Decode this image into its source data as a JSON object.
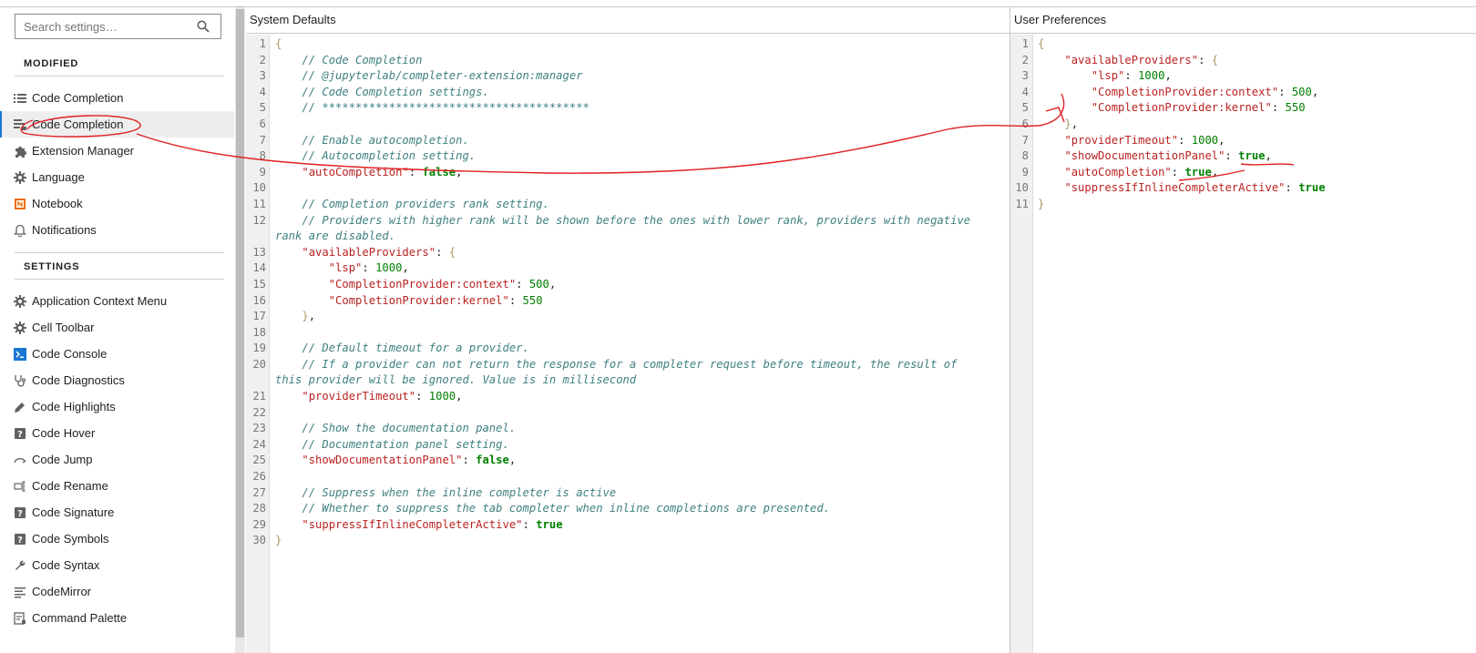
{
  "search": {
    "placeholder": "Search settings…"
  },
  "sidebar": {
    "modified_header": "MODIFIED",
    "settings_header": "SETTINGS",
    "modified_items": [
      {
        "label": "Code Completion",
        "icon": "list-icon"
      },
      {
        "label": "Code Completion",
        "icon": "completion-icon"
      },
      {
        "label": "Extension Manager",
        "icon": "puzzle-icon"
      },
      {
        "label": "Language",
        "icon": "gear-icon"
      },
      {
        "label": "Notebook",
        "icon": "notebook-icon"
      },
      {
        "label": "Notifications",
        "icon": "bell-icon"
      }
    ],
    "settings_items": [
      {
        "label": "Application Context Menu",
        "icon": "gear-icon"
      },
      {
        "label": "Cell Toolbar",
        "icon": "gear-icon"
      },
      {
        "label": "Code Console",
        "icon": "console-icon"
      },
      {
        "label": "Code Diagnostics",
        "icon": "stethoscope-icon"
      },
      {
        "label": "Code Highlights",
        "icon": "pen-icon"
      },
      {
        "label": "Code Hover",
        "icon": "help-icon"
      },
      {
        "label": "Code Jump",
        "icon": "jump-icon"
      },
      {
        "label": "Code Rename",
        "icon": "rename-icon"
      },
      {
        "label": "Code Signature",
        "icon": "help-icon"
      },
      {
        "label": "Code Symbols",
        "icon": "help-icon"
      },
      {
        "label": "Code Syntax",
        "icon": "wrench-icon"
      },
      {
        "label": "CodeMirror",
        "icon": "text-lines-icon"
      },
      {
        "label": "Command Palette",
        "icon": "palette-icon"
      }
    ]
  },
  "system_defaults": {
    "title": "System Defaults",
    "lines": [
      [
        [
          "p",
          "{"
        ]
      ],
      [
        [
          "t",
          "    "
        ],
        [
          "c",
          "// Code Completion"
        ]
      ],
      [
        [
          "t",
          "    "
        ],
        [
          "c",
          "// @jupyterlab/completer-extension:manager"
        ]
      ],
      [
        [
          "t",
          "    "
        ],
        [
          "c",
          "// Code Completion settings."
        ]
      ],
      [
        [
          "t",
          "    "
        ],
        [
          "c",
          "// ****************************************"
        ]
      ],
      [],
      [
        [
          "t",
          "    "
        ],
        [
          "c",
          "// Enable autocompletion."
        ]
      ],
      [
        [
          "t",
          "    "
        ],
        [
          "c",
          "// Autocompletion setting."
        ]
      ],
      [
        [
          "t",
          "    "
        ],
        [
          "k",
          "\"autoCompletion\""
        ],
        [
          "t",
          ": "
        ],
        [
          "b",
          "false"
        ],
        [
          "t",
          ","
        ]
      ],
      [],
      [
        [
          "t",
          "    "
        ],
        [
          "c",
          "// Completion providers rank setting."
        ]
      ],
      [
        [
          "t",
          "    "
        ],
        [
          "c",
          "// Providers with higher rank will be shown before the ones with lower rank, providers with negative"
        ]
      ],
      [
        [
          "c",
          "rank are disabled."
        ]
      ],
      [
        [
          "t",
          "    "
        ],
        [
          "k",
          "\"availableProviders\""
        ],
        [
          "t",
          ": "
        ],
        [
          "p",
          "{"
        ]
      ],
      [
        [
          "t",
          "        "
        ],
        [
          "k",
          "\"lsp\""
        ],
        [
          "t",
          ": "
        ],
        [
          "n",
          "1000"
        ],
        [
          "t",
          ","
        ]
      ],
      [
        [
          "t",
          "        "
        ],
        [
          "k",
          "\"CompletionProvider:context\""
        ],
        [
          "t",
          ": "
        ],
        [
          "n",
          "500"
        ],
        [
          "t",
          ","
        ]
      ],
      [
        [
          "t",
          "        "
        ],
        [
          "k",
          "\"CompletionProvider:kernel\""
        ],
        [
          "t",
          ": "
        ],
        [
          "n",
          "550"
        ]
      ],
      [
        [
          "t",
          "    "
        ],
        [
          "p",
          "}"
        ],
        [
          "t",
          ","
        ]
      ],
      [],
      [
        [
          "t",
          "    "
        ],
        [
          "c",
          "// Default timeout for a provider."
        ]
      ],
      [
        [
          "t",
          "    "
        ],
        [
          "c",
          "// If a provider can not return the response for a completer request before timeout, the result of"
        ]
      ],
      [
        [
          "c",
          "this provider will be ignored. Value is in millisecond"
        ]
      ],
      [
        [
          "t",
          "    "
        ],
        [
          "k",
          "\"providerTimeout\""
        ],
        [
          "t",
          ": "
        ],
        [
          "n",
          "1000"
        ],
        [
          "t",
          ","
        ]
      ],
      [],
      [
        [
          "t",
          "    "
        ],
        [
          "c",
          "// Show the documentation panel."
        ]
      ],
      [
        [
          "t",
          "    "
        ],
        [
          "c",
          "// Documentation panel setting."
        ]
      ],
      [
        [
          "t",
          "    "
        ],
        [
          "k",
          "\"showDocumentationPanel\""
        ],
        [
          "t",
          ": "
        ],
        [
          "b",
          "false"
        ],
        [
          "t",
          ","
        ]
      ],
      [],
      [
        [
          "t",
          "    "
        ],
        [
          "c",
          "// Suppress when the inline completer is active"
        ]
      ],
      [
        [
          "t",
          "    "
        ],
        [
          "c",
          "// Whether to suppress the tab completer when inline completions are presented."
        ]
      ],
      [
        [
          "t",
          "    "
        ],
        [
          "k",
          "\"suppressIfInlineCompleterActive\""
        ],
        [
          "t",
          ": "
        ],
        [
          "b",
          "true"
        ]
      ],
      [
        [
          "p",
          "}"
        ]
      ]
    ],
    "line_numbers": [
      "1",
      "2",
      "3",
      "4",
      "5",
      "6",
      "7",
      "8",
      "9",
      "10",
      "11",
      "12",
      "",
      "13",
      "14",
      "15",
      "16",
      "17",
      "18",
      "19",
      "20",
      "",
      "21",
      "22",
      "23",
      "24",
      "25",
      "26",
      "27",
      "28",
      "29",
      "30"
    ]
  },
  "user_preferences": {
    "title": "User Preferences",
    "lines": [
      [
        [
          "p",
          "{"
        ]
      ],
      [
        [
          "t",
          "    "
        ],
        [
          "k",
          "\"availableProviders\""
        ],
        [
          "t",
          ": "
        ],
        [
          "p",
          "{"
        ]
      ],
      [
        [
          "t",
          "        "
        ],
        [
          "k",
          "\"lsp\""
        ],
        [
          "t",
          ": "
        ],
        [
          "n",
          "1000"
        ],
        [
          "t",
          ","
        ]
      ],
      [
        [
          "t",
          "        "
        ],
        [
          "k",
          "\"CompletionProvider:context\""
        ],
        [
          "t",
          ": "
        ],
        [
          "n",
          "500"
        ],
        [
          "t",
          ","
        ]
      ],
      [
        [
          "t",
          "        "
        ],
        [
          "k",
          "\"CompletionProvider:kernel\""
        ],
        [
          "t",
          ": "
        ],
        [
          "n",
          "550"
        ]
      ],
      [
        [
          "t",
          "    "
        ],
        [
          "p",
          "}"
        ],
        [
          "t",
          ","
        ]
      ],
      [
        [
          "t",
          "    "
        ],
        [
          "k",
          "\"providerTimeout\""
        ],
        [
          "t",
          ": "
        ],
        [
          "n",
          "1000"
        ],
        [
          "t",
          ","
        ]
      ],
      [
        [
          "t",
          "    "
        ],
        [
          "k",
          "\"showDocumentationPanel\""
        ],
        [
          "t",
          ": "
        ],
        [
          "b",
          "true"
        ],
        [
          "t",
          ","
        ]
      ],
      [
        [
          "t",
          "    "
        ],
        [
          "k",
          "\"autoCompletion\""
        ],
        [
          "t",
          ": "
        ],
        [
          "b",
          "true"
        ],
        [
          "t",
          ","
        ]
      ],
      [
        [
          "t",
          "    "
        ],
        [
          "k",
          "\"suppressIfInlineCompleterActive\""
        ],
        [
          "t",
          ": "
        ],
        [
          "b",
          "true"
        ]
      ],
      [
        [
          "p",
          "}"
        ]
      ]
    ],
    "line_numbers": [
      "1",
      "2",
      "3",
      "4",
      "5",
      "6",
      "7",
      "8",
      "9",
      "10",
      "11"
    ]
  }
}
